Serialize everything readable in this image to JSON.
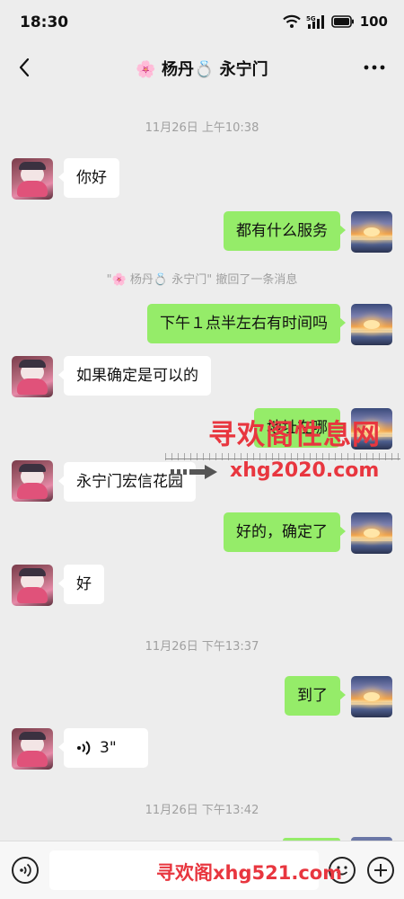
{
  "status_bar": {
    "time": "18:30",
    "battery": "100",
    "icons": [
      "wifi-icon",
      "signal-5g-icon",
      "battery-icon"
    ]
  },
  "header": {
    "title": "🌸 杨丹💍 永宁门",
    "back_icon": "chevron-left-icon",
    "more_icon": "more-dots-icon"
  },
  "messages": [
    {
      "type": "timestamp",
      "text": "11月26日 上午10:38"
    },
    {
      "type": "text",
      "side": "left",
      "text": "你好"
    },
    {
      "type": "text",
      "side": "right",
      "text": "都有什么服务"
    },
    {
      "type": "recall",
      "text": "\"🌸 杨丹💍 永宁门\" 撤回了一条消息"
    },
    {
      "type": "text",
      "side": "right",
      "text": "下午１点半左右有时间吗"
    },
    {
      "type": "text",
      "side": "left",
      "text": "如果确定是可以的"
    },
    {
      "type": "text",
      "side": "right",
      "text": "地址在哪"
    },
    {
      "type": "text",
      "side": "left",
      "text": "永宁门宏信花园"
    },
    {
      "type": "text",
      "side": "right",
      "text": "好的，确定了"
    },
    {
      "type": "text",
      "side": "left",
      "text": "好"
    },
    {
      "type": "timestamp",
      "text": "11月26日 下午13:37"
    },
    {
      "type": "text",
      "side": "right",
      "text": "到了"
    },
    {
      "type": "voice",
      "side": "left",
      "duration": "3\""
    },
    {
      "type": "timestamp",
      "text": "11月26日 下午13:42"
    }
  ],
  "watermarks": {
    "big": "寻欢阁性息网",
    "url": "xhg2020.com",
    "bottom": "寻欢阁xhg521.com"
  },
  "input_bar": {
    "placeholder": "",
    "voice_icon": "voice-input-icon",
    "emoji_icon": "emoji-icon",
    "plus_icon": "plus-icon"
  },
  "colors": {
    "background": "#ededed",
    "sent_bubble": "#95ec69",
    "received_bubble": "#ffffff",
    "watermark": "#e8363f"
  }
}
